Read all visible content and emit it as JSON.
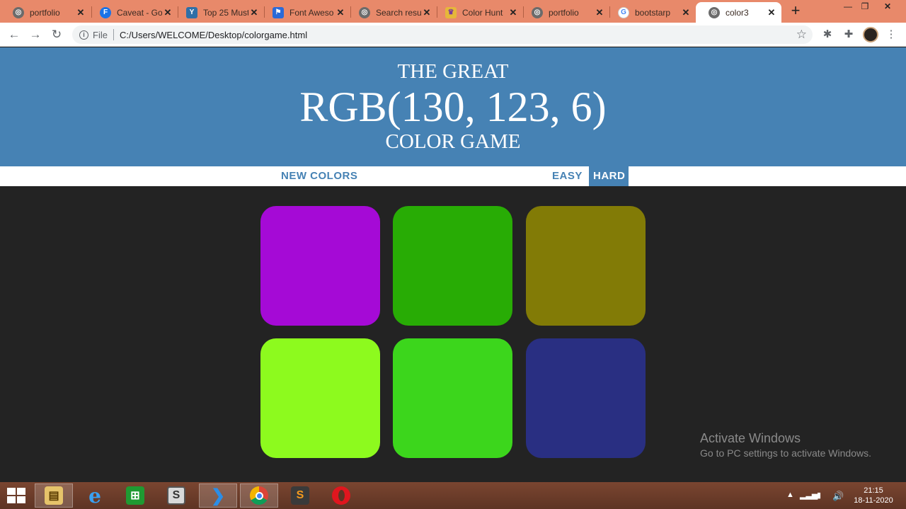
{
  "browser": {
    "tabs": [
      {
        "title": "portfolio",
        "icon": "globe-icon"
      },
      {
        "title": "Caveat - Go",
        "icon": "fonts-icon"
      },
      {
        "title": "Top 25 Must",
        "icon": "y-logo-icon"
      },
      {
        "title": "Font Aweso",
        "icon": "flag-icon"
      },
      {
        "title": "Search resul",
        "icon": "globe-icon"
      },
      {
        "title": "Color Hunt",
        "icon": "trophy-icon"
      },
      {
        "title": "portfolio",
        "icon": "globe-icon"
      },
      {
        "title": "bootstarp",
        "icon": "google-icon"
      },
      {
        "title": "color3",
        "icon": "globe-icon",
        "active": true
      }
    ],
    "address": {
      "file_label": "File",
      "url": "C:/Users/WELCOME/Desktop/colorgame.html"
    }
  },
  "game": {
    "title_line1": "THE GREAT",
    "color_display": "RGB(130, 123, 6)",
    "title_line3": "COLOR GAME",
    "header_color": "#4682b4",
    "background": "#232323",
    "reset_label": "NEW COLORS",
    "message": "",
    "easy_label": "EASY",
    "hard_label": "HARD",
    "selected_mode": "HARD",
    "squares": [
      "#a50ad6",
      "#28ac05",
      "#827b06",
      "#8dfa1e",
      "#3cd61c",
      "#292f82"
    ]
  },
  "watermark": {
    "line1": "Activate Windows",
    "line2": "Go to PC settings to activate Windows."
  },
  "taskbar": {
    "apps": [
      "file-explorer-icon",
      "internet-explorer-icon",
      "store-icon",
      "sublime-icon",
      "vscode-icon",
      "chrome-icon",
      "sublime-text-icon",
      "opera-icon"
    ],
    "time": "21:15",
    "date": "18-11-2020"
  }
}
